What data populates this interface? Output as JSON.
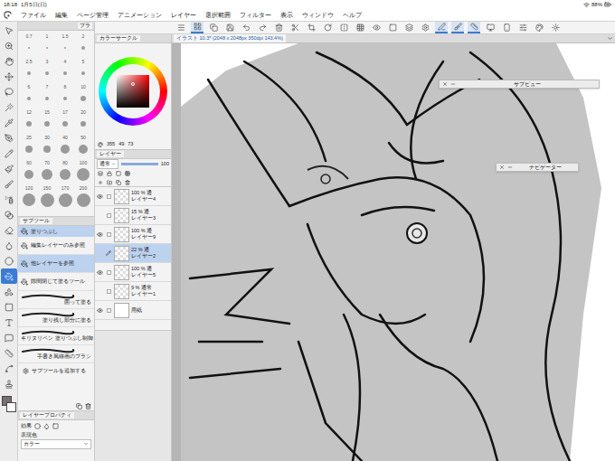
{
  "status_bar": {
    "time": "18:18",
    "date": "1月5日(日)",
    "battery": "88%"
  },
  "menu": [
    "ファイル",
    "編集",
    "ページ管理",
    "アニメーション",
    "レイヤー",
    "選択範囲",
    "フィルター",
    "表示",
    "ウィンドウ",
    "ヘルプ"
  ],
  "command_bar": [
    {
      "selected": false
    },
    {
      "selected": true
    },
    {
      "selected": false
    },
    {
      "selected": false
    },
    {
      "selected": false
    },
    {
      "selected": false
    },
    {
      "selected": false
    },
    {
      "selected": false
    },
    {
      "selected": false
    },
    {
      "selected": false
    },
    {
      "selected": false
    },
    {
      "selected": false
    },
    {
      "selected": false
    },
    {
      "selected": false
    },
    {
      "selected": false
    },
    {
      "selected": false
    },
    {
      "selected": true
    },
    {
      "selected": true
    },
    {
      "selected": true
    },
    {
      "selected": false
    },
    {
      "selected": false
    },
    {
      "selected": false
    },
    {
      "selected": false
    },
    {
      "selected": false
    }
  ],
  "tools": [
    {
      "selected": false
    },
    {
      "selected": false
    },
    {
      "selected": false
    },
    {
      "selected": false
    },
    {
      "selected": false
    },
    {
      "selected": false
    },
    {
      "selected": false
    },
    {
      "selected": false
    },
    {
      "selected": false
    },
    {
      "selected": false
    },
    {
      "selected": false
    },
    {
      "selected": false
    },
    {
      "selected": false
    },
    {
      "selected": false
    },
    {
      "selected": false
    },
    {
      "selected": false
    },
    {
      "selected": true
    },
    {
      "selected": false
    },
    {
      "selected": false
    },
    {
      "selected": false
    },
    {
      "selected": false
    },
    {
      "selected": false
    },
    {
      "selected": false
    },
    {
      "selected": false
    }
  ],
  "brush_panel": {
    "title": "ブラ",
    "sizes": [
      "0.7",
      "1",
      "1.5",
      "2",
      "2.5",
      "3",
      "4",
      "5",
      "6",
      "7",
      "8",
      "10",
      "12",
      "15",
      "17",
      "20",
      "25",
      "30",
      "40",
      "50",
      "60",
      "70",
      "80",
      "100",
      "120",
      "150",
      "170",
      "200"
    ]
  },
  "sub_tool_panel": {
    "title": "サブツール",
    "group": "塗りつぶし",
    "items": [
      {
        "label": "編集レイヤーのみ参照",
        "selected": false,
        "kind": "icon"
      },
      {
        "label": "他レイヤーを参照",
        "selected": true,
        "kind": "icon"
      },
      {
        "label": "隙間閉じて塗るツール",
        "selected": false,
        "kind": "icon"
      },
      {
        "label": "囲って塗る",
        "selected": false,
        "kind": "stroke"
      },
      {
        "label": "塗り残し部分に塗る",
        "selected": false,
        "kind": "stroke"
      },
      {
        "label": "キリヌリペン 塗りつぶし制御",
        "selected": false,
        "kind": "stroke"
      },
      {
        "label": "手書き風線画のブラシ",
        "selected": false,
        "kind": "stroke"
      }
    ],
    "add": "サブツールを追加する"
  },
  "layer_property": {
    "title": "レイヤープロパティ",
    "effect": "効果",
    "color_label": "表現色",
    "color_value": "カラー"
  },
  "color_panel": {
    "title": "カラーサークル",
    "readings": [
      "355",
      "49",
      "73"
    ]
  },
  "layer_panel": {
    "title": "レイヤー",
    "blend": "通常",
    "opacity": "100",
    "layers": [
      {
        "opacity": "100 %",
        "blend": "通",
        "name": "レイヤー4",
        "visible": true,
        "selected": false,
        "kind": "raster"
      },
      {
        "opacity": "15 %",
        "blend": "通",
        "name": "レイヤー3",
        "visible": false,
        "selected": false,
        "kind": "raster"
      },
      {
        "opacity": "100 %",
        "blend": "通",
        "name": "レイヤー9",
        "visible": true,
        "selected": false,
        "kind": "raster"
      },
      {
        "opacity": "22 %",
        "blend": "通",
        "name": "レイヤー2",
        "visible": false,
        "selected": true,
        "kind": "raster"
      },
      {
        "opacity": "100 %",
        "blend": "通",
        "name": "レイヤー5",
        "visible": true,
        "selected": false,
        "kind": "raster"
      },
      {
        "opacity": "9 %",
        "blend": "通常",
        "name": "レイヤー1",
        "visible": false,
        "selected": false,
        "kind": "raster"
      },
      {
        "opacity": "",
        "blend": "",
        "name": "用紙",
        "visible": true,
        "selected": false,
        "kind": "paper"
      }
    ]
  },
  "canvas": {
    "tab": "イラスト 10.3* (2048 x 2048px 350dpi 143.4%)",
    "subview_title": "サブビュー",
    "navigator_title": "ナビゲーター"
  }
}
